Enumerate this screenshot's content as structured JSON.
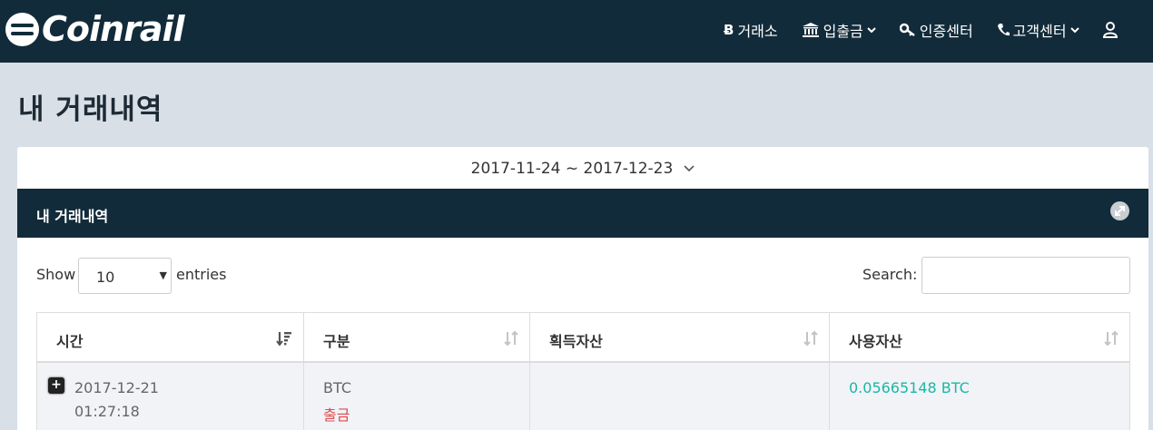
{
  "brand": {
    "name": "Coinrail"
  },
  "nav": {
    "exchange": "거래소",
    "deposit": "입출금",
    "verification": "인증센터",
    "support": "고객센터"
  },
  "page": {
    "title": "내 거래내역"
  },
  "date_filter": {
    "range": "2017-11-24 ~ 2017-12-23"
  },
  "panel": {
    "title": "내 거래내역"
  },
  "controls": {
    "show_label": "Show",
    "entries_value": "10",
    "entries_label": "entries",
    "search_label": "Search:",
    "search_value": ""
  },
  "table": {
    "headers": [
      "시간",
      "구분",
      "획득자산",
      "사용자산"
    ],
    "rows": [
      {
        "date": "2017-12-21",
        "time": "01:27:18",
        "currency": "BTC",
        "type": "출금",
        "acquired": "",
        "used": "0.05665148 BTC"
      }
    ]
  },
  "colors": {
    "navy": "#122b3a",
    "background": "#d9dfe7",
    "withdraw_red": "#e04b4b",
    "teal": "#1ab7a6"
  }
}
